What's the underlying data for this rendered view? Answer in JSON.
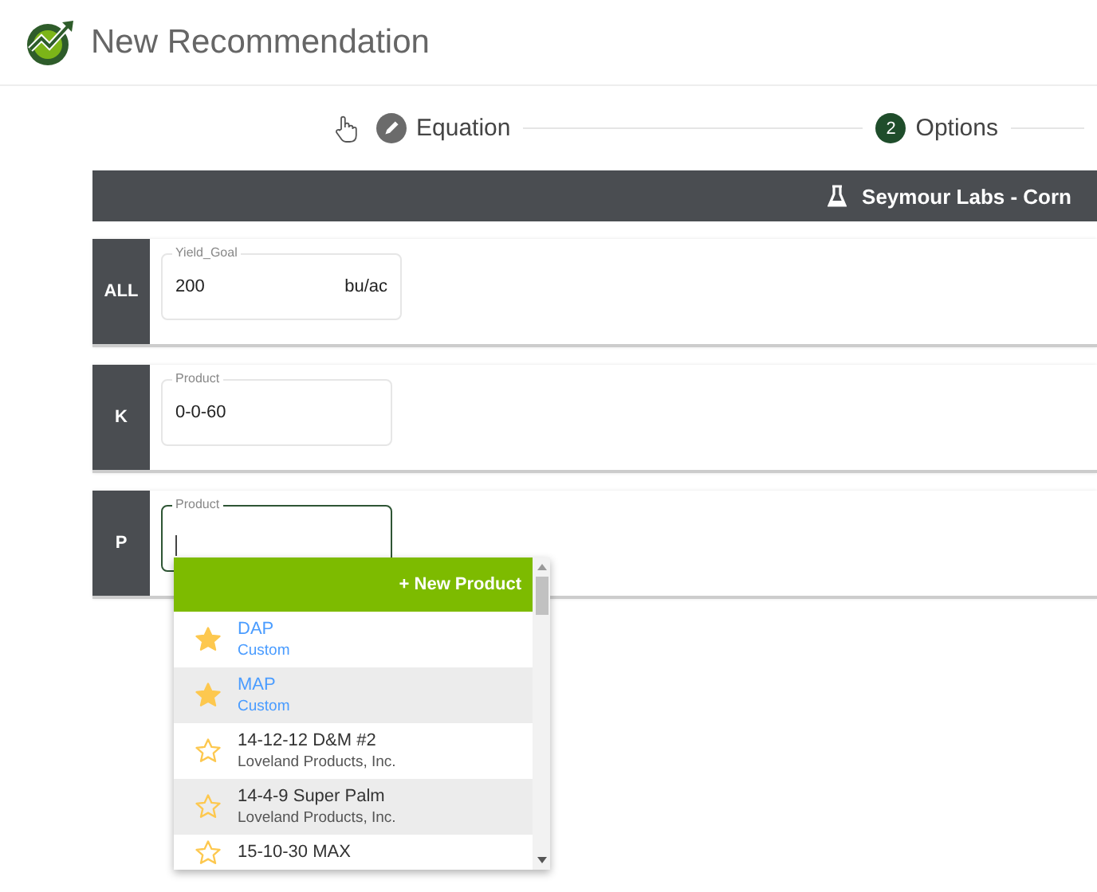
{
  "header": {
    "title": "New Recommendation"
  },
  "steps": [
    {
      "kind": "edit",
      "label": "Equation"
    },
    {
      "kind": "number",
      "number": "2",
      "label": "Options"
    }
  ],
  "lab_bar": {
    "title": "Seymour Labs - Corn"
  },
  "rows": [
    {
      "tag": "ALL",
      "field": {
        "label": "Yield_Goal",
        "value": "200",
        "unit": "bu/ac",
        "focused": false
      }
    },
    {
      "tag": "K",
      "field": {
        "label": "Product",
        "value": "0-0-60",
        "focused": false
      }
    },
    {
      "tag": "P",
      "field": {
        "label": "Product",
        "focused": true
      }
    }
  ],
  "dropdown": {
    "action": "+ New Product",
    "items": [
      {
        "name": "DAP",
        "source": "Custom",
        "favorite": true,
        "kind": "custom"
      },
      {
        "name": "MAP",
        "source": "Custom",
        "favorite": true,
        "kind": "custom"
      },
      {
        "name": "14-12-12 D&M #2",
        "source": "Loveland Products, Inc.",
        "favorite": false,
        "kind": "vendor"
      },
      {
        "name": "14-4-9 Super Palm",
        "source": "Loveland Products, Inc.",
        "favorite": false,
        "kind": "vendor"
      },
      {
        "name": "15-10-30 MAX",
        "favorite": false,
        "kind": "vendor"
      }
    ]
  }
}
